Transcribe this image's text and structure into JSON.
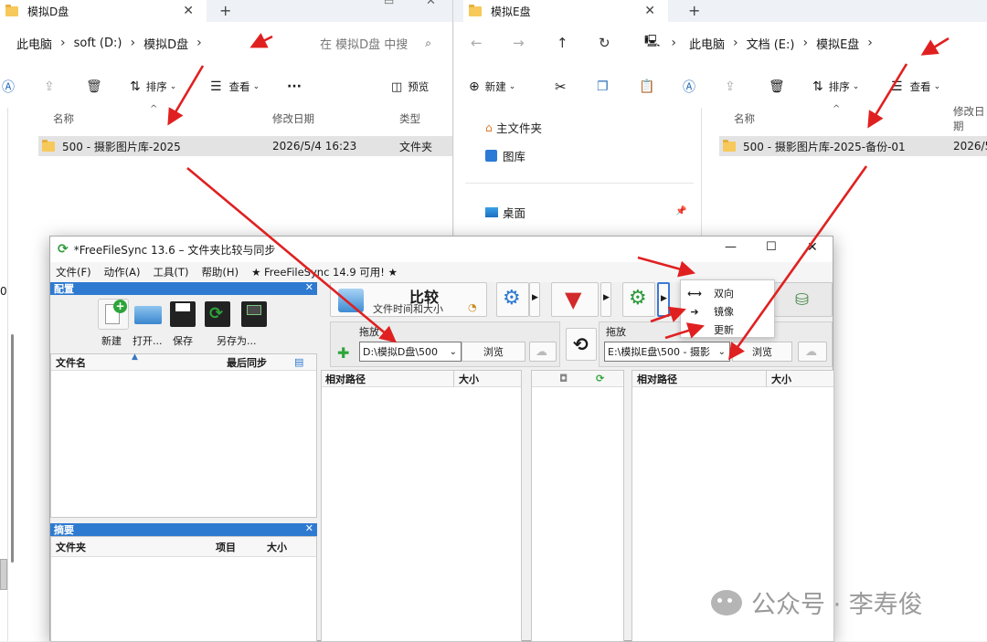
{
  "left_explorer": {
    "tab_title": "模拟D盘",
    "breadcrumb": [
      "此电脑",
      "soft (D:)",
      "模拟D盘"
    ],
    "search_placeholder": "在 模拟D盘 中搜",
    "toolbar": {
      "sort": "排序",
      "view": "查看",
      "more": "···",
      "preview": "预览"
    },
    "columns": {
      "name": "名称",
      "modified": "修改日期",
      "type": "类型"
    },
    "file": {
      "name": "500 - 摄影图片库-2025",
      "modified": "2026/5/4 16:23",
      "type": "文件夹"
    },
    "side_digit": "0"
  },
  "right_explorer": {
    "tab_title": "模拟E盘",
    "breadcrumb": [
      "此电脑",
      "文档 (E:)",
      "模拟E盘"
    ],
    "toolbar": {
      "new": "新建",
      "sort": "排序",
      "view": "查看"
    },
    "nav": [
      "主文件夹",
      "图库",
      "桌面"
    ],
    "columns": {
      "name": "名称",
      "modified": "修改日期"
    },
    "file": {
      "name": "500 - 摄影图片库-2025-备份-01",
      "modified": "2026/5"
    }
  },
  "ffs": {
    "title": "*FreeFileSync 13.6 – 文件夹比较与同步",
    "menu": [
      "文件(F)",
      "动作(A)",
      "工具(T)",
      "帮助(H)",
      "★ FreeFileSync 14.9 可用! ★"
    ],
    "config_panel": {
      "header": "配置",
      "buttons": [
        "新建",
        "打开...",
        "保存",
        "另存为..."
      ],
      "col_name": "文件名",
      "col_last_sync": "最后同步"
    },
    "summary_panel": {
      "header": "摘要",
      "col_folder": "文件夹",
      "col_items": "项目",
      "col_size": "大小"
    },
    "compare": {
      "label": "比较",
      "sub": "文件时间和大小"
    },
    "drop_label": "拖放",
    "left_path": "D:\\模拟D盘\\500",
    "right_path": "E:\\模拟E盘\\500 - 摄影",
    "browse": "浏览",
    "grid_left": {
      "rel_path": "相对路径",
      "size": "大小"
    },
    "grid_right": {
      "rel_path": "相对路径",
      "size": "大小"
    },
    "sync_menu": [
      "双向",
      "镜像",
      "更新"
    ]
  },
  "watermark": "公众号 · 李寿俊",
  "colors": {
    "annotation_red": "#e02020",
    "ffs_panel_blue": "#2e7ad1",
    "folder_yellow": "#f7c95a"
  }
}
